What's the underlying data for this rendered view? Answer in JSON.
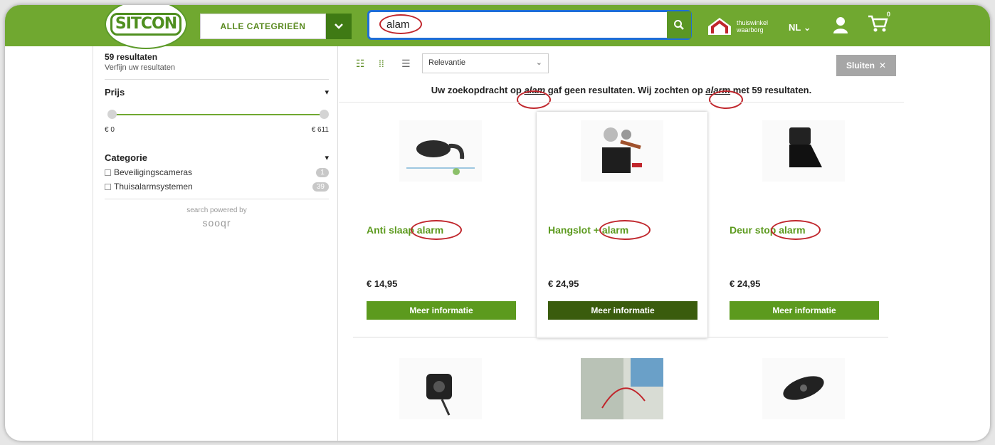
{
  "header": {
    "logo_text": "SITCON",
    "category_button": "ALLE CATEGRIEËN",
    "search_value": "alam",
    "brand_text_line1": "thuiswinkel",
    "brand_text_line2": "waarborg",
    "language": "NL",
    "cart_count": "0"
  },
  "sidebar": {
    "results_count": "59 resultaten",
    "refine_label": "Verfijn uw resultaten",
    "price_title": "Prijs",
    "price_min": "€ 0",
    "price_max": "€ 611",
    "category_title": "Categorie",
    "categories": [
      {
        "label": "Beveiligingscameras",
        "count": "1"
      },
      {
        "label": "Thuisalarmsystemen",
        "count": "39"
      }
    ],
    "powered_by": "search powered by",
    "powered_brand": "sooqr"
  },
  "toolbar": {
    "sort_value": "Relevantie",
    "close_label": "Sluiten"
  },
  "message": {
    "part1": "Uw zoekopdracht op ",
    "term1": "alam",
    "part2": " gaf geen resultaten. Wij zochten op ",
    "term2": "alarm",
    "part3": " met 59 resultaten."
  },
  "products": [
    {
      "title": "Anti slaap alarm",
      "price": "€ 14,95",
      "button": "Meer informatie"
    },
    {
      "title": "Hangslot + alarm",
      "price": "€ 24,95",
      "button": "Meer informatie"
    },
    {
      "title": "Deur stop alarm",
      "price": "€ 24,95",
      "button": "Meer informatie"
    }
  ],
  "colors": {
    "brand_green": "#70a830",
    "dark_green": "#3a5c0d",
    "annotation_red": "#c0262c"
  }
}
